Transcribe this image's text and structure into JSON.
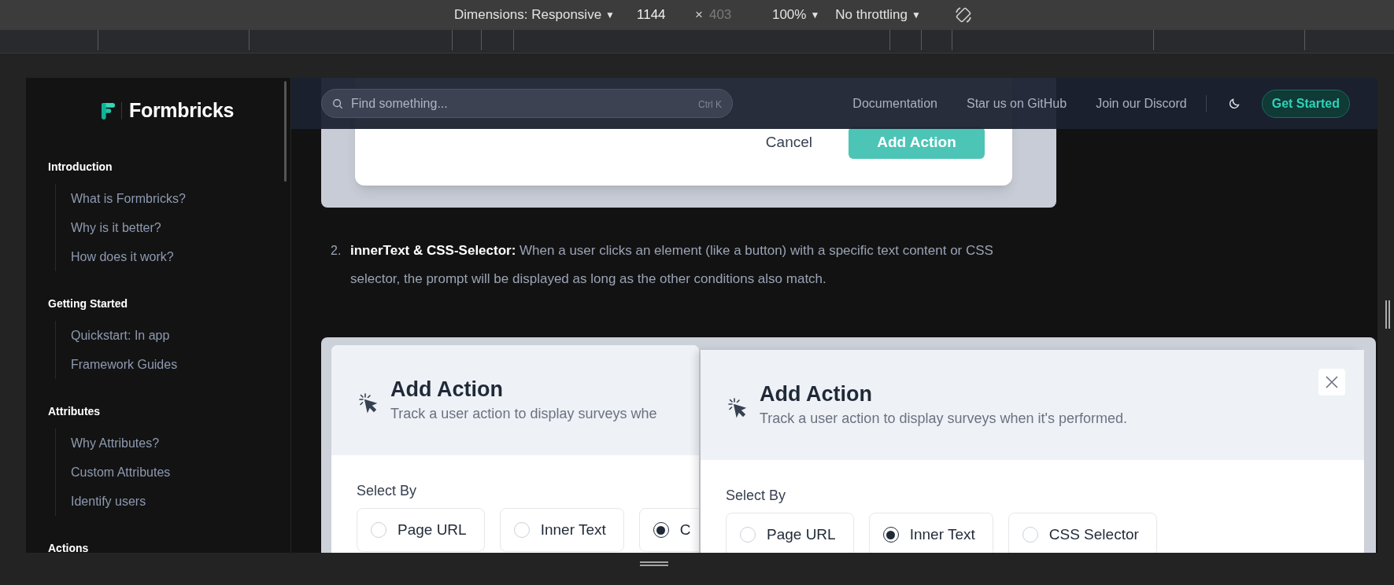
{
  "devtools_toolbar": {
    "dimensions": {
      "label": "Dimensions: Responsive",
      "caret": "▼"
    },
    "width_value": "1144",
    "times": "×",
    "height_placeholder": "403",
    "zoom": {
      "label": "100%",
      "caret": "▼"
    },
    "throttling": {
      "label": "No throttling",
      "caret": "▼"
    }
  },
  "sidebar": {
    "logo_text": "Formbricks",
    "sections": [
      {
        "title": "Introduction",
        "items": [
          "What is Formbricks?",
          "Why is it better?",
          "How does it work?"
        ]
      },
      {
        "title": "Getting Started",
        "items": [
          "Quickstart: In app",
          "Framework Guides"
        ]
      },
      {
        "title": "Attributes",
        "items": [
          "Why Attributes?",
          "Custom Attributes",
          "Identify users"
        ]
      },
      {
        "title": "Actions"
      }
    ]
  },
  "header": {
    "search": {
      "placeholder": "Find something...",
      "shortcut": "Ctrl K"
    },
    "links": [
      "Documentation",
      "Star us on GitHub",
      "Join our Discord"
    ],
    "cta": "Get Started"
  },
  "content": {
    "figure_1": {
      "cancel": "Cancel",
      "confirm": "Add Action"
    },
    "list_item": {
      "number": "2.",
      "text": "**innerText & CSS-Selector:** When a user clicks an element (like a button) with a specific text content or CSS selector, the prompt will be displayed as long as the other conditions also match."
    },
    "figure_2": {
      "dialogs": [
        {
          "title": "Add Action",
          "subtitle": "Track a user action to display surveys whe",
          "select_by": "Select By",
          "close_button": false,
          "options": [
            {
              "label": "Page URL",
              "selected": false
            },
            {
              "label": "Inner Text",
              "selected": false
            },
            {
              "label": "C",
              "selected": true
            }
          ]
        },
        {
          "title": "Add Action",
          "subtitle": "Track a user action to display surveys when it's performed.",
          "select_by": "Select By",
          "close_button": true,
          "options": [
            {
              "label": "Page URL",
              "selected": false
            },
            {
              "label": "Inner Text",
              "selected": true
            },
            {
              "label": "CSS Selector",
              "selected": false
            }
          ]
        }
      ]
    }
  }
}
